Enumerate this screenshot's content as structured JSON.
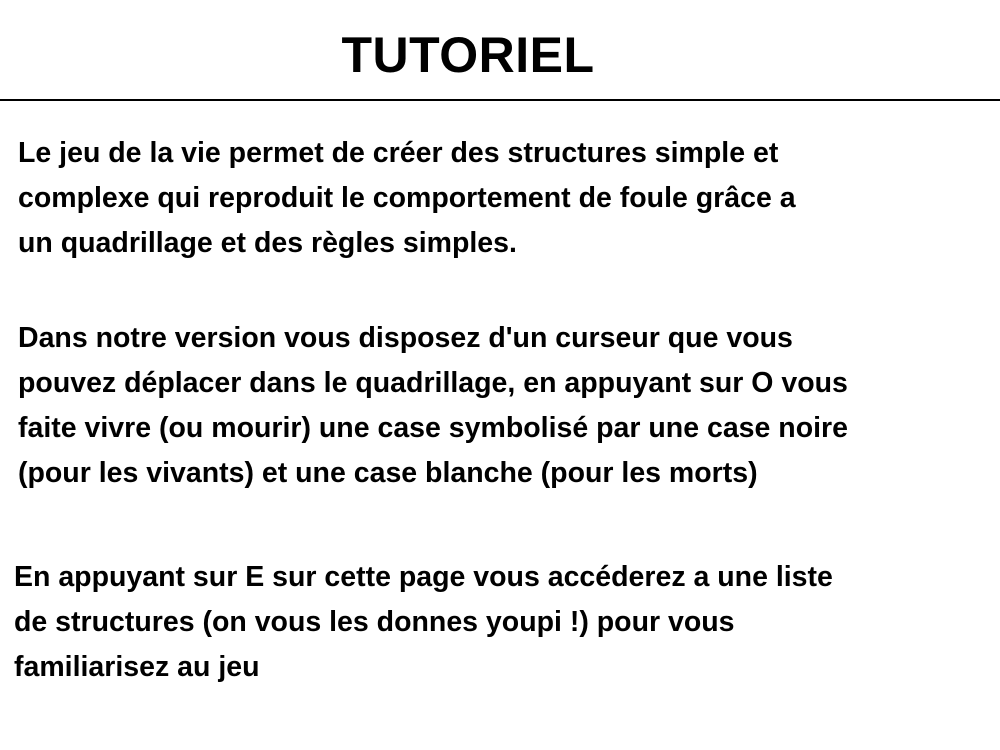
{
  "title": "TUTORIEL",
  "paragraphs": [
    {
      "lines": [
        "Le jeu de la vie permet de créer des structures simple et",
        "complexe qui reproduit le comportement de foule grâce a",
        "un quadrillage et des règles simples."
      ]
    },
    {
      "lines": [
        "Dans notre version vous disposez d'un curseur que vous",
        "pouvez déplacer dans le quadrillage, en appuyant sur O vous",
        "faite vivre (ou mourir) une case symbolisé par une case noire",
        "(pour les vivants) et une case blanche (pour les morts)"
      ]
    },
    {
      "lines": [
        "En appuyant sur E sur cette page vous accéderez a une liste",
        "de structures (on vous les donnes youpi !) pour vous",
        "familiarisez au jeu"
      ]
    }
  ]
}
